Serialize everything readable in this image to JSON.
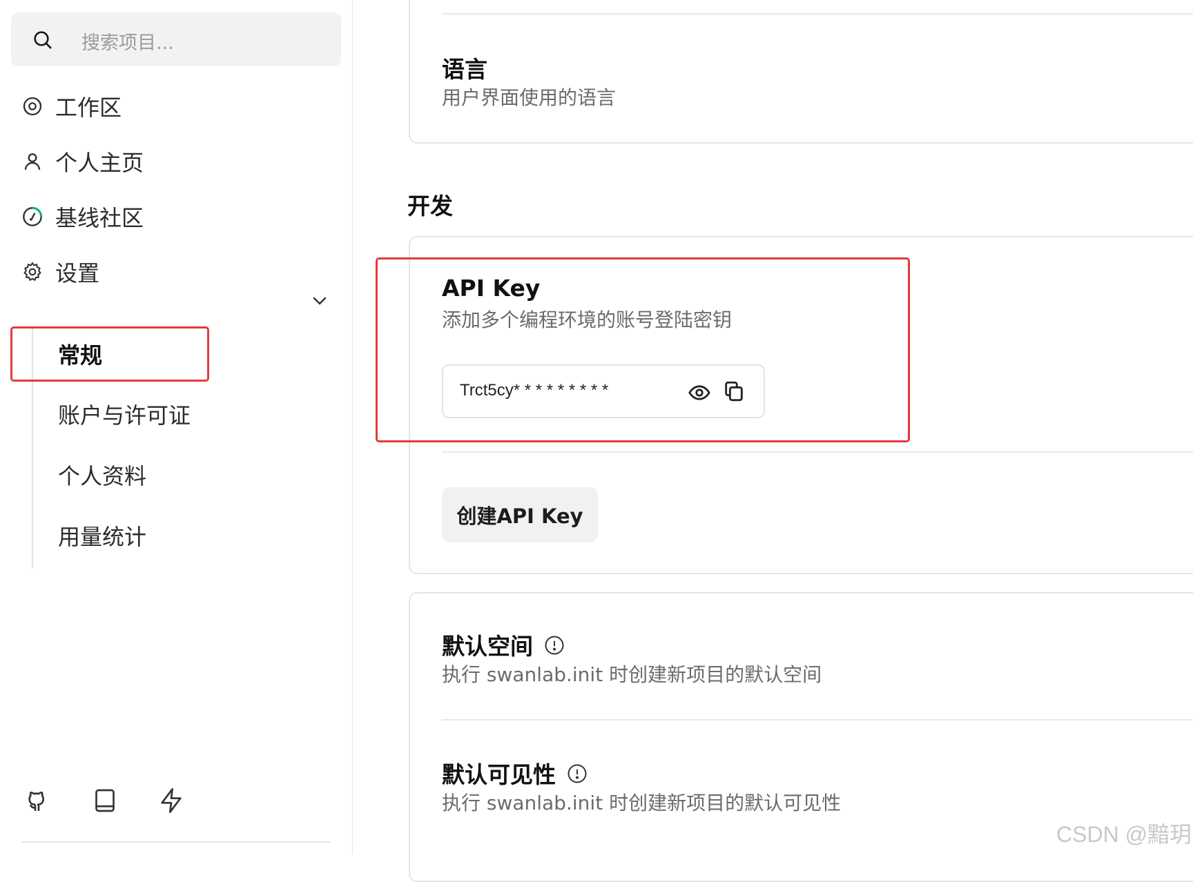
{
  "sidebar": {
    "search_placeholder": "搜索项目...",
    "nav": [
      {
        "label": "工作区",
        "icon": "workspace-icon"
      },
      {
        "label": "个人主页",
        "icon": "user-icon"
      },
      {
        "label": "基线社区",
        "icon": "compass-icon"
      },
      {
        "label": "设置",
        "icon": "gear-icon"
      }
    ],
    "settings_sub": [
      "常规",
      "账户与许可证",
      "个人资料",
      "用量统计"
    ],
    "active_sub": "常规",
    "bottom_icons": [
      "github-icon",
      "book-icon",
      "lightning-icon"
    ]
  },
  "main": {
    "language": {
      "title": "语言",
      "desc": "用户界面使用的语言"
    },
    "dev_section_title": "开发",
    "api_key": {
      "title": "API Key",
      "desc": "添加多个编程环境的账号登陆密钥",
      "value": "Trct5cy* * * * * * * * *",
      "create_button": "创建API Key"
    },
    "default_space": {
      "title": "默认空间",
      "desc": "执行 swanlab.init 时创建新项目的默认空间"
    },
    "default_visibility": {
      "title": "默认可见性",
      "desc": "执行 swanlab.init 时创建新项目的默认可见性"
    }
  },
  "watermark": "CSDN @黯玥",
  "colors": {
    "highlight": "#e5393b",
    "accent_green": "#18b36b"
  }
}
